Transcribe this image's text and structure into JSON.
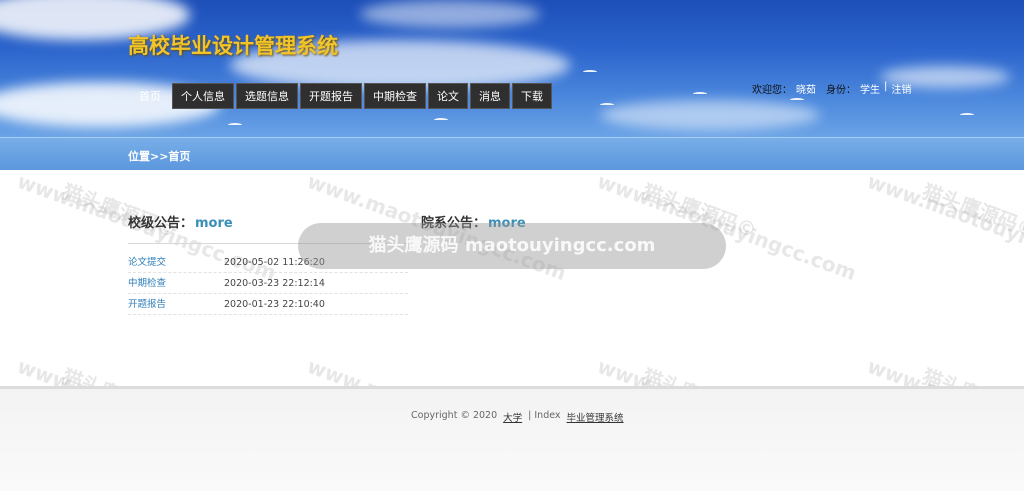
{
  "header": {
    "site_title": "高校毕业设计管理系统",
    "nav": [
      "首页",
      "个人信息",
      "选题信息",
      "开题报告",
      "中期检查",
      "论文",
      "消息",
      "下载"
    ],
    "user": {
      "welcome_label": "欢迎您：",
      "username": "晓茹",
      "identity_label": "身份：",
      "role": "学生",
      "separator": "|",
      "logout": "注销"
    }
  },
  "breadcrumb": "位置>>首页",
  "school_notice": {
    "title": "校级公告：",
    "more": "more",
    "items": [
      {
        "title": "论文提交",
        "date": "2020-05-02 11:26:20"
      },
      {
        "title": "中期检查",
        "date": "2020-03-23 22:12:14"
      },
      {
        "title": "开题报告",
        "date": "2020-01-23 22:10:40"
      }
    ]
  },
  "dept_notice": {
    "title": "院系公告：",
    "more": "more"
  },
  "watermark": {
    "pill": "猫头鹰源码 maotouyingcc.com",
    "diag_text": "www.maotouyingcc.com",
    "diag_cn": "猫头鹰源码©"
  },
  "footer": {
    "copyright": "Copyright © 2020",
    "univ": "大学",
    "sep": "| Index",
    "system": "毕业管理系统"
  }
}
